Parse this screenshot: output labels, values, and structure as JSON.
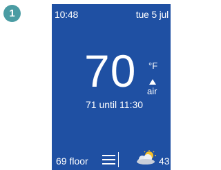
{
  "step": {
    "number": "1",
    "color": "#4a9ca3"
  },
  "thermostat": {
    "background_color": "#1f50a3",
    "status_bar": {
      "time": "10:48",
      "date": "tue 5 jul"
    },
    "main": {
      "temperature": "70",
      "unit": "°F",
      "mode_icon": "arrow-up-icon",
      "mode": "air",
      "schedule_text": "71 until 11:30"
    },
    "bottom_bar": {
      "floor_text": "69 floor",
      "menu_icon": "menu-icon",
      "weather_icon": "partly-cloudy-icon",
      "outdoor_temp": "43"
    }
  }
}
